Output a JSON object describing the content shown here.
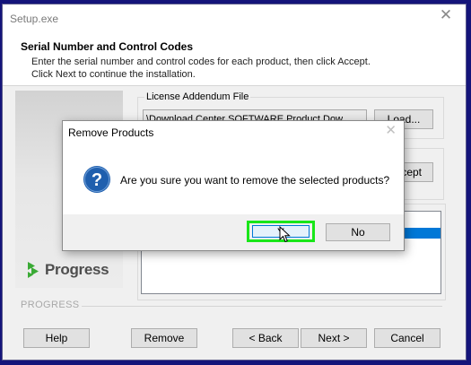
{
  "window": {
    "title": "Setup.exe",
    "close_icon": "close-icon"
  },
  "header": {
    "title": "Serial Number and Control Codes",
    "description": "Enter the serial number and control codes for each product, then click Accept. Click Next to continue the installation."
  },
  "branding": {
    "logo_text": "Progress",
    "logo_color": "#3aaa35",
    "section_label": "PROGRESS"
  },
  "license": {
    "group_label": "License Addendum File",
    "path_value": "\\Download Center    SOFTWARE    Product Dow",
    "load_button": "Load...",
    "accept_button": "cept"
  },
  "dialog": {
    "title": "Remove Products",
    "message": "Are you sure you want to remove the selected products?",
    "question_icon": "question-icon",
    "yes_button": "Y",
    "no_button": "No",
    "highlight_color": "#19e619"
  },
  "footer": {
    "help": "Help",
    "remove": "Remove",
    "back": "< Back",
    "next": "Next >",
    "cancel": "Cancel"
  },
  "colors": {
    "desktop": "#14147a",
    "selection": "#0078d7",
    "question_icon_bg": "#1f5fae"
  }
}
